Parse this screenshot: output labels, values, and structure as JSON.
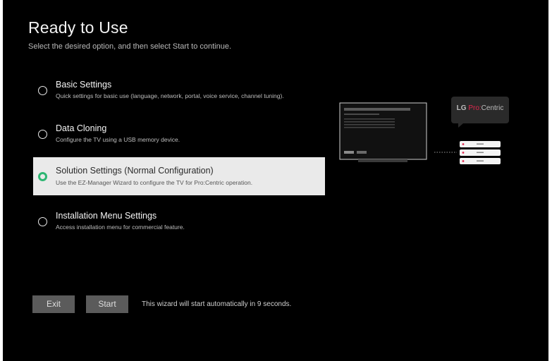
{
  "header": {
    "title": "Ready to Use",
    "subtitle": "Select the desired option, and then select Start to continue."
  },
  "options": [
    {
      "title": "Basic Settings",
      "description": "Quick settings for basic use (language, network, portal, voice service, channel tuning).",
      "selected": false
    },
    {
      "title": "Data Cloning",
      "description": "Configure the TV using a USB memory device.",
      "selected": false
    },
    {
      "title": "Solution Settings (Normal Configuration)",
      "description": "Use the EZ-Manager Wizard to configure the TV for Pro:Centric operation.",
      "selected": true
    },
    {
      "title": "Installation Menu Settings",
      "description": "Access installation menu for commercial feature.",
      "selected": false
    }
  ],
  "footer": {
    "exit_label": "Exit",
    "start_label": "Start",
    "auto_start_text": "This wizard will start automatically in 9 seconds."
  },
  "illustration": {
    "logo_brand": "LG",
    "logo_product_accent": "Pro:",
    "logo_product": "Centric"
  },
  "colors": {
    "background": "#000000",
    "selected_background": "#eaeaea",
    "selected_radio": "#2eb673",
    "button": "#5b5b5b",
    "logo_accent": "#e0284e"
  }
}
